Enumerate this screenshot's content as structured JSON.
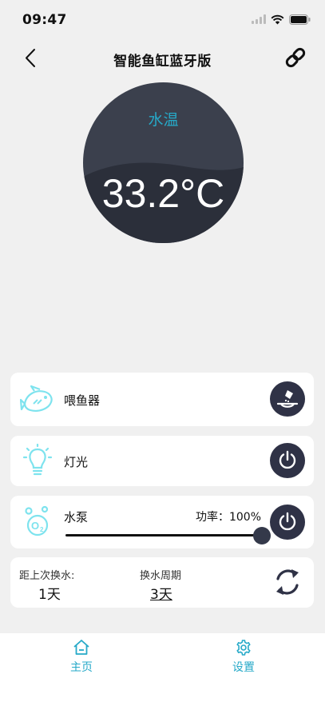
{
  "status_bar": {
    "time": "09:47"
  },
  "nav": {
    "title": "智能鱼缸蓝牙版"
  },
  "gauge": {
    "label": "水温",
    "value": "33.2°C"
  },
  "feeder": {
    "label": "喂鱼器"
  },
  "light": {
    "label": "灯光"
  },
  "pump": {
    "label": "水泵",
    "power_text": "功率：100%",
    "power_percent": 100
  },
  "water_change": {
    "since_label": "距上次换水:",
    "since_value": "1天",
    "cycle_label": "换水周期",
    "cycle_value": "3天"
  },
  "tabs": [
    {
      "label": "主页"
    },
    {
      "label": "设置"
    }
  ],
  "colors": {
    "accent": "#26a9c8",
    "dark": "#2f3246",
    "gauge_top": "#3b404d",
    "gauge_bottom": "#2b2f3a",
    "icon_cyan": "#7ee3ee"
  }
}
